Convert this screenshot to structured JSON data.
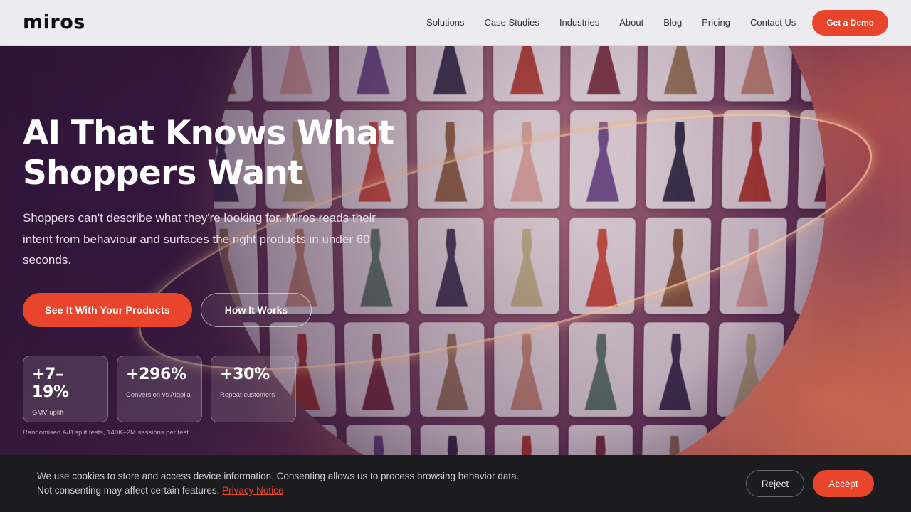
{
  "brand": {
    "logo_text": "miros"
  },
  "nav": {
    "items": [
      {
        "label": "Solutions"
      },
      {
        "label": "Case Studies"
      },
      {
        "label": "Industries"
      },
      {
        "label": "About"
      },
      {
        "label": "Blog"
      },
      {
        "label": "Pricing"
      },
      {
        "label": "Contact Us"
      }
    ],
    "cta_label": "Get a Demo"
  },
  "hero": {
    "title_line1": "AI That Knows What",
    "title_line2": "Shoppers Want",
    "subtitle": "Shoppers can't describe what they're looking for. Miros reads their intent from behaviour and surfaces the right products in under 60 seconds.",
    "primary_cta": "See It With Your Products",
    "secondary_cta": "How It Works",
    "stats": [
      {
        "value": "+7–19%",
        "label": "GMV uplift"
      },
      {
        "value": "+296%",
        "label": "Conversion vs Algolia"
      },
      {
        "value": "+30%",
        "label": "Repeat customers"
      }
    ],
    "footnote": "Randomised A/B split tests, 140K–2M sessions per test"
  },
  "cookie_banner": {
    "text": "We use cookies to store and access device information. Consenting allows us to process browsing behavior data. Not consenting may affect certain features.",
    "link_label": "Privacy Notice",
    "reject_label": "Reject",
    "accept_label": "Accept"
  },
  "colors": {
    "accent": "#e8452c",
    "header_bg": "#ecebef",
    "cookie_bg": "#1c1b1d"
  }
}
